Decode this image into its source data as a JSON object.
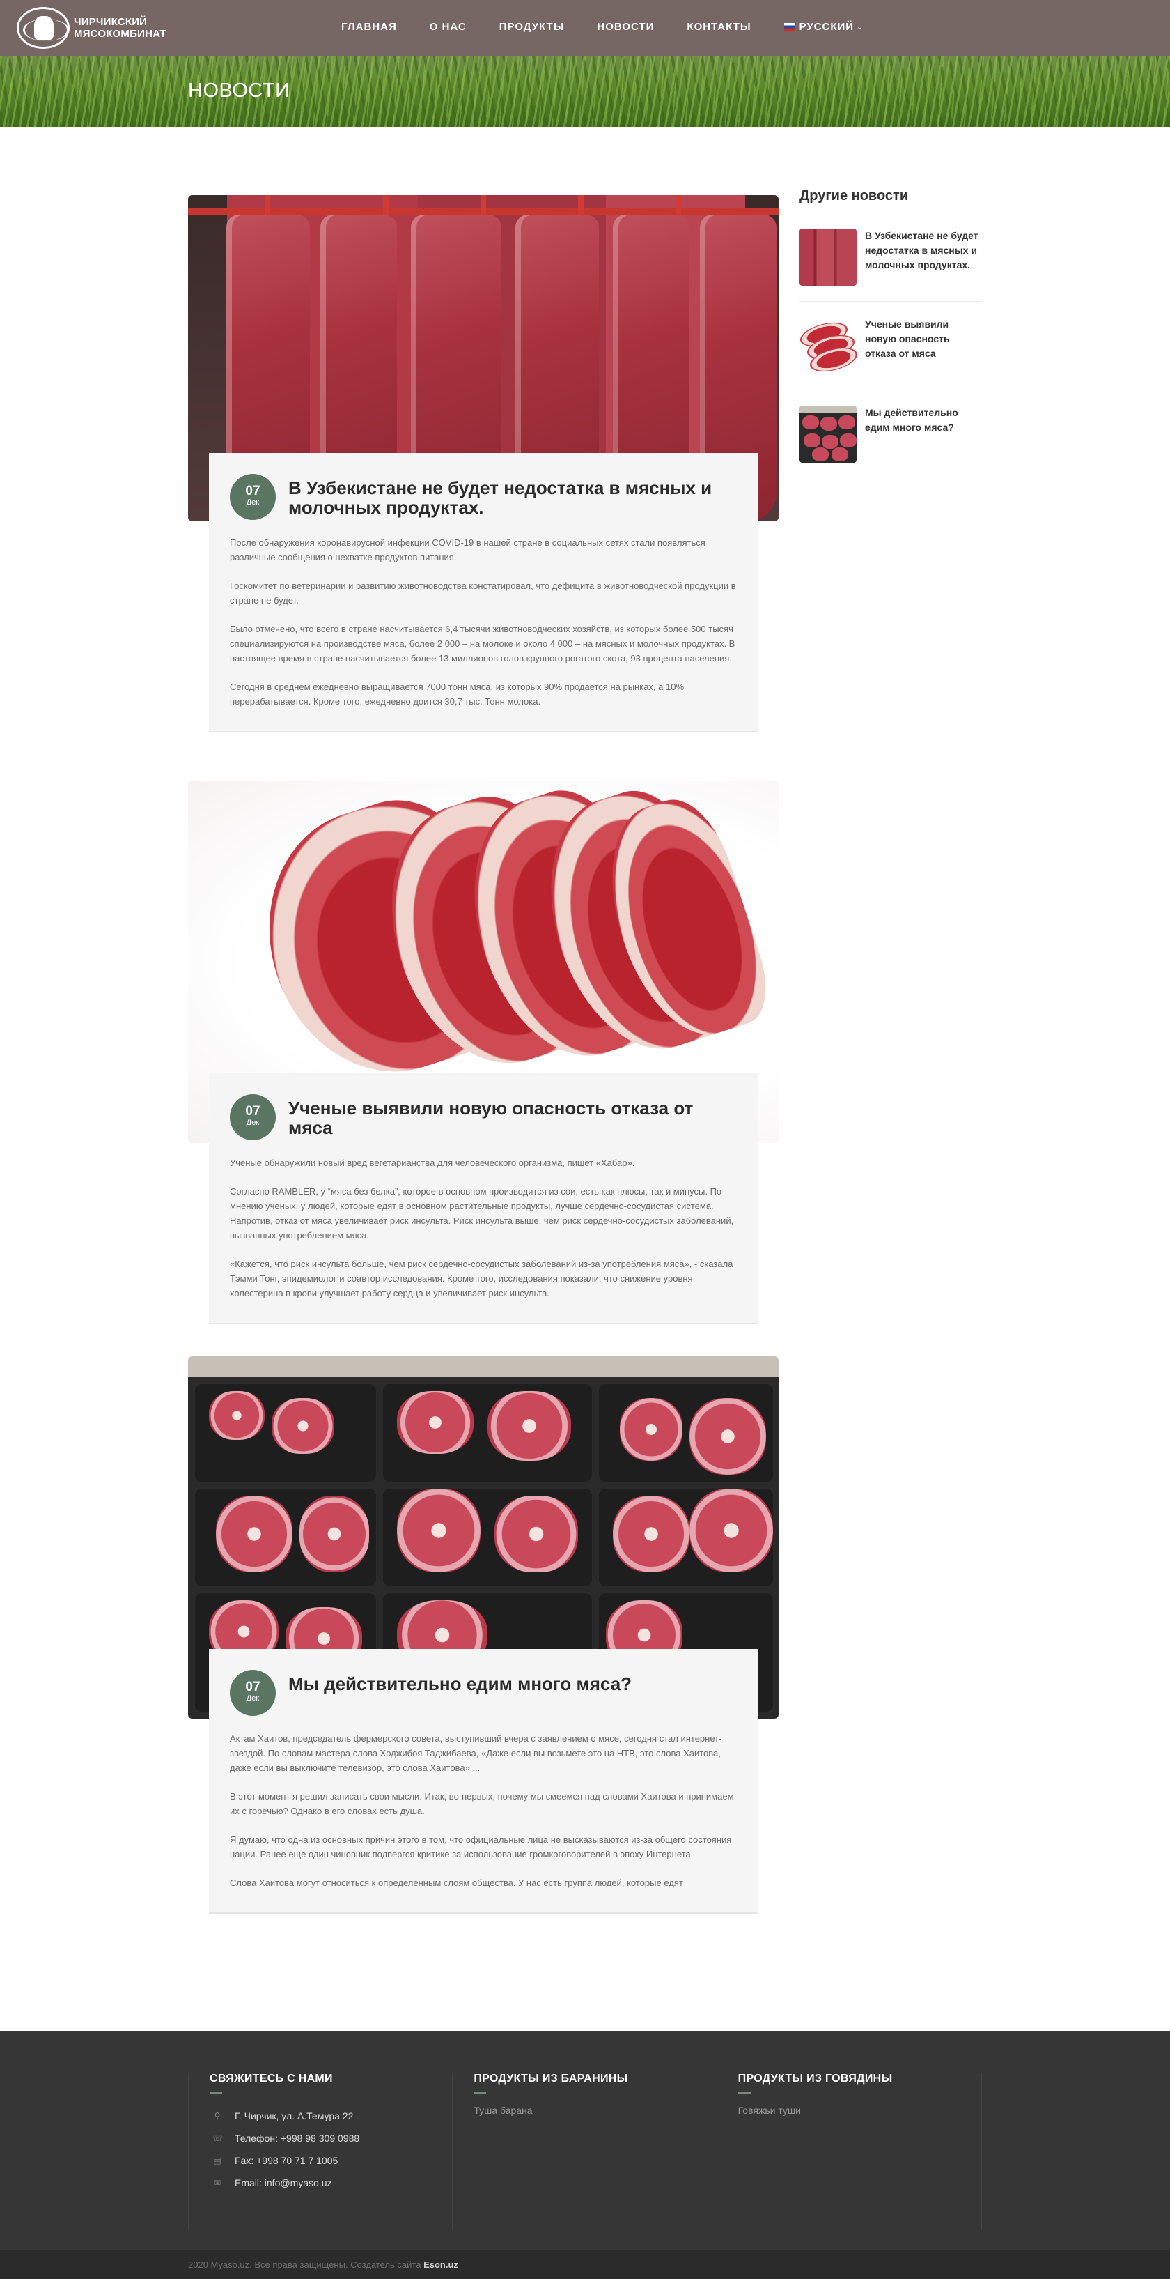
{
  "header": {
    "logo_line1": "Чирчикский",
    "logo_line2": "мясокомбинат",
    "nav": [
      "Главная",
      "О нас",
      "Продукты",
      "Новости",
      "Контакты"
    ],
    "language": "Русский",
    "page_title": "Новости"
  },
  "posts": [
    {
      "day": "07",
      "month": "Дек",
      "title": "В Узбекистане не будет недостатка в мясных и молочных продуктах.",
      "paragraphs": [
        "После обнаружения коронавирусной инфекции COVID-19 в нашей стране в социальных сетях стали появляться различные сообщения о нехватке продуктов питания.",
        "Госкомитет по ветеринарии и развитию животноводства констатировал, что дефицита в животноводческой продукции в стране не будет.",
        "Было отмечено, что всего в стране насчитывается 6,4 тысячи животноводческих хозяйств, из которых более 500 тысяч специализируются на производстве мяса, более 2 000 – на молоке и около 4 000 – на мясных и молочных продуктах. В настоящее время в стране насчитывается более 13 миллионов голов крупного рогатого скота, 93 процента населения.",
        "Сегодня в среднем ежедневно выращивается 7000 тонн мяса, из которых 90% продается на рынках, а 10% перерабатывается. Кроме того, ежедневно доится 30,7 тыс. Тонн молока."
      ]
    },
    {
      "day": "07",
      "month": "Дек",
      "title": "Ученые выявили новую опасность отказа от мяса",
      "paragraphs": [
        "Ученые обнаружили новый вред вегетарианства для человеческого организма, пишет «Хабар».",
        "Согласно RAMBLER, у “мяса без белка”, которое в основном производится из сои, есть как плюсы, так и минусы. По мнению ученых, у людей, которые едят в основном растительные продукты, лучше сердечно-сосудистая система. Напротив, отказ от мяса увеличивает риск инсульта. Риск инсульта выше, чем риск сердечно-сосудистых заболеваний, вызванных употреблением мяса.",
        "«Кажется, что риск инсульта больше, чем риск сердечно-сосудистых заболеваний из-за употребления мяса», - сказала Тэмми Тонг, эпидемиолог и соавтор исследования. Кроме того, исследования показали, что снижение уровня холестерина в крови улучшает работу сердца и увеличивает риск инсульта."
      ]
    },
    {
      "day": "07",
      "month": "Дек",
      "title": "Мы действительно едим много мяса?",
      "paragraphs": [
        "Актам Хаитов, председатель фермерского совета, выступивший вчера с заявлением о мясе, сегодня стал интернет-звездой. По словам мастера слова Ходжибоя Таджибаева, «Даже если вы возьмете это на НТВ, это слова Хаитова, даже если вы выключите телевизор, это слова Хаитова» ...",
        "В этот момент я решил записать свои мысли. Итак, во-первых, почему мы смеемся над словами Хаитова и принимаем их с горечью? Однако в его словах есть душа.",
        "Я думаю, что одна из основных причин этого в том, что официальные лица не высказываются из-за общего состояния нации. Ранее еще один чиновник подвергся критике за использование громкоговорителей в эпоху Интернета.",
        "Слова Хаитова могут относиться к определенным слоям общества. У нас есть группа людей, которые едят"
      ]
    }
  ],
  "sidebar": {
    "title": "Другие новости",
    "items": [
      "В Узбекистане не будет недостатка в мясных и молочных продуктах.",
      "Ученые выявили новую опасность отказа от мяса",
      "Мы действительно едим много мяса?"
    ]
  },
  "footer": {
    "contact_title": "Свяжитесь с нами",
    "address": "Г. Чирчик, ул. А.Темура 22",
    "phone": "Телефон: +998 98 309 0988",
    "fax": "Fax: +998 70 71 7 1005",
    "email": "Email: info@myaso.uz",
    "lamb_title": "Продукты из баранины",
    "lamb_link": "Туша барана",
    "beef_title": "Продукты из говядины",
    "beef_link": "Говяжьи туши",
    "copyright_text": "2020 Myaso.uz. Все права защищены. Создатель сайта",
    "copyright_brand": "Eson.uz"
  },
  "icons": {
    "address": "map-marker-icon",
    "phone": "phone-icon",
    "fax": "fax-icon",
    "email": "envelope-icon"
  },
  "colors": {
    "date_badge": "#5a7663",
    "navbar": "#766664",
    "footer": "#363636"
  }
}
